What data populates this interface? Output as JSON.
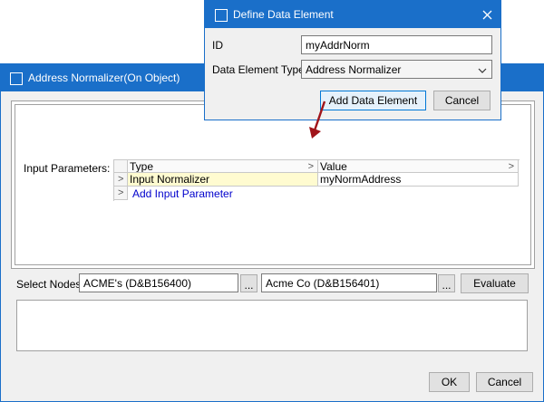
{
  "main_window": {
    "title": "Address Normalizer(On Object)",
    "input_parameters_label": "Input Parameters:",
    "grid": {
      "columns": [
        "Type",
        "Value"
      ],
      "rows": [
        {
          "type": "Input Normalizer",
          "value": "myNormAddress"
        }
      ],
      "add_row_label": "Add Input Parameter"
    },
    "select_nodes_label": "Select Nodes",
    "node1_value": "ACME's (D&B156400)",
    "node2_value": "Acme Co (D&B156401)",
    "browse_label": "...",
    "evaluate_label": "Evaluate",
    "ok_label": "OK",
    "cancel_label": "Cancel"
  },
  "dialog": {
    "title": "Define Data Element",
    "id_label": "ID",
    "id_value": "myAddrNorm",
    "type_label": "Data Element Type",
    "type_value": "Address Normalizer",
    "add_label": "Add Data Element",
    "cancel_label": "Cancel"
  },
  "colors": {
    "titlebar": "#1a6fc9",
    "selected_cell": "#fffbd0",
    "link": "#0000cc",
    "arrow": "#a0141a"
  },
  "icons": [
    "window-icon",
    "close-icon",
    "chevron-right-icon",
    "chevron-down-icon",
    "row-pointer-icon",
    "arrow-annotation-icon"
  ]
}
